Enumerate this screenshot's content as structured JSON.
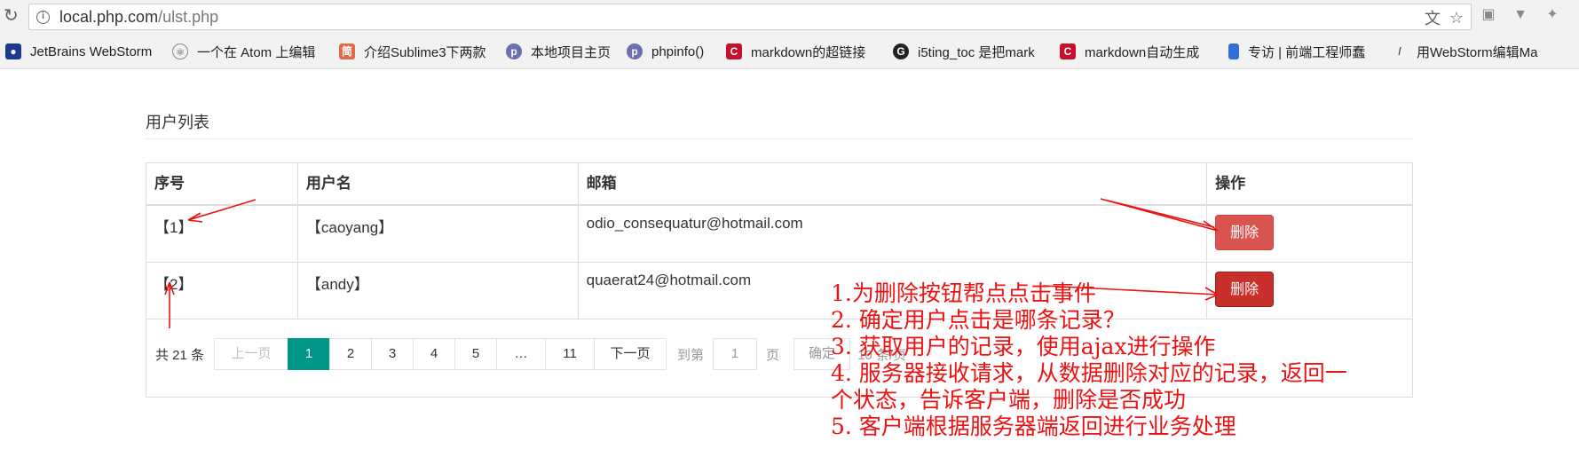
{
  "browser": {
    "url_host": "local.php.com",
    "url_path": "/ulst.php",
    "bookmarks": [
      {
        "label": "JetBrains WebStorm",
        "icon": "paw-icon",
        "color": "#1a3a8f"
      },
      {
        "label": "一个在 Atom 上编辑",
        "icon": "atom-icon",
        "color": "#555555"
      },
      {
        "label": "介绍Sublime3下两款",
        "icon": "jianshu-icon",
        "color": "#e06b4a"
      },
      {
        "label": "本地项目主页",
        "icon": "php-elephant-icon",
        "color": "#6b6fb0"
      },
      {
        "label": "phpinfo()",
        "icon": "php-elephant-icon",
        "color": "#6b6fb0"
      },
      {
        "label": "markdown的超链接",
        "icon": "csdn-icon",
        "color": "#c8102e"
      },
      {
        "label": "i5ting_toc 是把mark",
        "icon": "github-icon",
        "color": "#222222"
      },
      {
        "label": "markdown自动生成",
        "icon": "csdn-icon",
        "color": "#c8102e"
      },
      {
        "label": "专访 | 前端工程师蠢",
        "icon": "bookmark-icon",
        "color": "#2f6fd6"
      },
      {
        "label": "用WebStorm编辑Ma",
        "icon": "slash-icon",
        "color": "#555555"
      }
    ]
  },
  "page": {
    "title": "用户列表",
    "table": {
      "headers": [
        "序号",
        "用户名",
        "邮箱",
        "操作"
      ],
      "rows": [
        {
          "id": "【1】",
          "username": "【caoyang】",
          "email": "odio_consequatur@hotmail.com",
          "action": "删除"
        },
        {
          "id": "【2】",
          "username": "【andy】",
          "email": "quaerat24@hotmail.com",
          "action": "删除"
        }
      ]
    },
    "pagination": {
      "total": "共 21 条",
      "prev": "上一页",
      "pages": [
        "1",
        "2",
        "3",
        "4",
        "5",
        "…",
        "11"
      ],
      "active_page": "1",
      "next": "下一页",
      "goto_label": "到第",
      "goto_value": "1",
      "page_unit": "页",
      "confirm": "确定",
      "per_page": "10 条/页"
    }
  },
  "annotations": [
    "1.为删除按钮帮点点击事件",
    "2. 确定用户点击是哪条记录？",
    "3. 获取用户的记录，使用ajax进行操作",
    "4. 服务器接收请求，从数据删除对应的记录，返回一",
    "个状态，告诉客户端，删除是否成功",
    "5. 客户端根据服务器端返回进行业务处理"
  ],
  "colors": {
    "delete_button": "#d9534f",
    "delete_button_hover": "#c9302c",
    "pager_active": "#009688",
    "annotation": "#ee1111"
  }
}
